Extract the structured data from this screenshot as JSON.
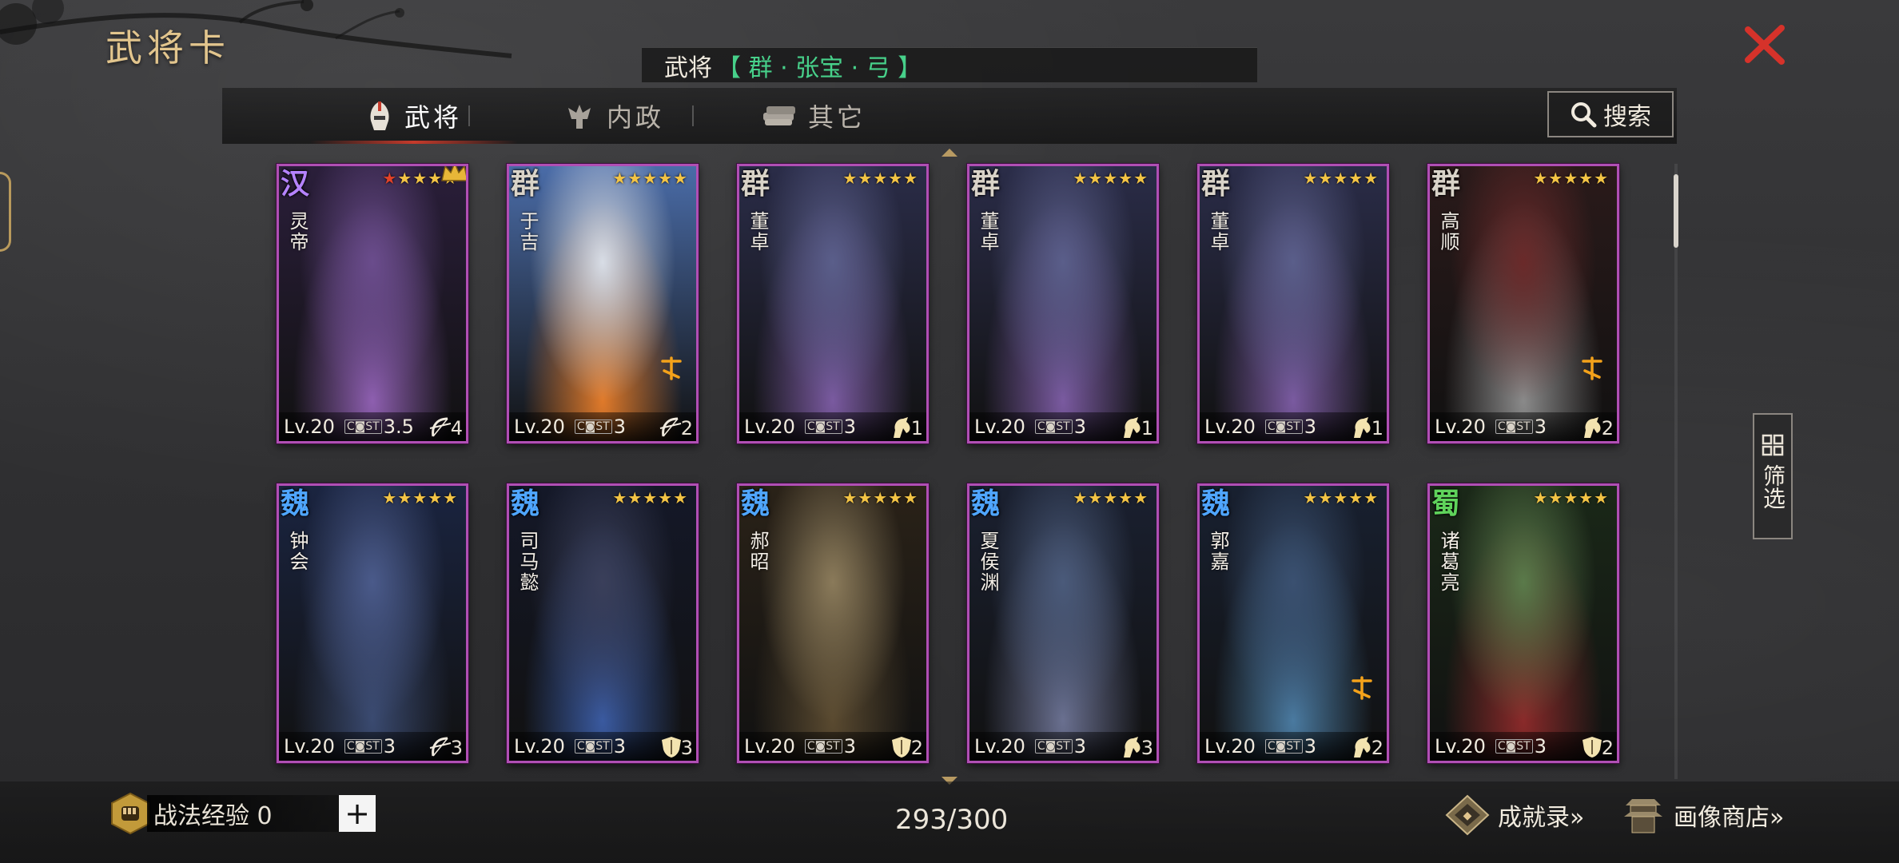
{
  "title": "武将卡",
  "selected": {
    "label": "武将",
    "value": "【 群 · 张宝 · 弓 】"
  },
  "tabs": [
    {
      "label": "武将",
      "icon": "helmet-icon",
      "active": true
    },
    {
      "label": "内政",
      "icon": "crown-ornament-icon",
      "active": false
    },
    {
      "label": "其它",
      "icon": "scroll-stack-icon",
      "active": false
    }
  ],
  "search_label": "搜索",
  "filter_label": "筛选",
  "cards": [
    {
      "faction": "汉",
      "faction_color": "#b583ff",
      "name": "灵帝",
      "stars": 5,
      "red_stars": 1,
      "level": "Lv.20",
      "cost": "3.5",
      "troop": "bow-icon",
      "troop_count": "4",
      "crown_badge": true,
      "awaken": false
    },
    {
      "faction": "群",
      "faction_color": "#d9d3c8",
      "name": "于吉",
      "stars": 5,
      "red_stars": 0,
      "level": "Lv.20",
      "cost": "3",
      "troop": "bow-icon",
      "troop_count": "2",
      "crown_badge": false,
      "awaken": true
    },
    {
      "faction": "群",
      "faction_color": "#d9d3c8",
      "name": "董卓",
      "stars": 5,
      "red_stars": 0,
      "level": "Lv.20",
      "cost": "3",
      "troop": "horse-icon",
      "troop_count": "1",
      "crown_badge": false,
      "awaken": false
    },
    {
      "faction": "群",
      "faction_color": "#d9d3c8",
      "name": "董卓",
      "stars": 5,
      "red_stars": 0,
      "level": "Lv.20",
      "cost": "3",
      "troop": "horse-icon",
      "troop_count": "1",
      "crown_badge": false,
      "awaken": false
    },
    {
      "faction": "群",
      "faction_color": "#d9d3c8",
      "name": "董卓",
      "stars": 5,
      "red_stars": 0,
      "level": "Lv.20",
      "cost": "3",
      "troop": "horse-icon",
      "troop_count": "1",
      "crown_badge": false,
      "awaken": false
    },
    {
      "faction": "群",
      "faction_color": "#d9d3c8",
      "name": "高顺",
      "stars": 5,
      "red_stars": 0,
      "level": "Lv.20",
      "cost": "3",
      "troop": "horse-icon",
      "troop_count": "2",
      "crown_badge": false,
      "awaken": true
    },
    {
      "faction": "魏",
      "faction_color": "#4fa6ff",
      "name": "钟会",
      "stars": 5,
      "red_stars": 0,
      "level": "Lv.20",
      "cost": "3",
      "troop": "bow-icon",
      "troop_count": "3",
      "crown_badge": false,
      "awaken": false
    },
    {
      "faction": "魏",
      "faction_color": "#4fa6ff",
      "name": "司马懿",
      "stars": 5,
      "red_stars": 0,
      "level": "Lv.20",
      "cost": "3",
      "troop": "shield-icon",
      "troop_count": "3",
      "crown_badge": false,
      "awaken": false
    },
    {
      "faction": "魏",
      "faction_color": "#4fa6ff",
      "name": "郝昭",
      "stars": 5,
      "red_stars": 0,
      "level": "Lv.20",
      "cost": "3",
      "troop": "shield-icon",
      "troop_count": "2",
      "crown_badge": false,
      "awaken": false
    },
    {
      "faction": "魏",
      "faction_color": "#4fa6ff",
      "name": "夏侯渊",
      "stars": 5,
      "red_stars": 0,
      "level": "Lv.20",
      "cost": "3",
      "troop": "horse-icon",
      "troop_count": "3",
      "crown_badge": false,
      "awaken": false
    },
    {
      "faction": "魏",
      "faction_color": "#4fa6ff",
      "name": "郭嘉",
      "stars": 5,
      "red_stars": 0,
      "level": "Lv.20",
      "cost": "3",
      "troop": "horse-icon",
      "troop_count": "2",
      "crown_badge": false,
      "awaken": true
    },
    {
      "faction": "蜀",
      "faction_color": "#5fd35b",
      "name": "诸葛亮",
      "stars": 5,
      "red_stars": 0,
      "level": "Lv.20",
      "cost": "3",
      "troop": "shield-icon",
      "troop_count": "2",
      "crown_badge": false,
      "awaken": false
    }
  ],
  "exp": {
    "label": "战法经验 0",
    "plus": "+"
  },
  "card_count": "293/300",
  "links": {
    "achievements": "成就录»",
    "portrait_shop": "画像商店»"
  },
  "colors": {
    "accent_gold": "#e2c58d",
    "card_border": "#b04fb4",
    "close_red": "#d6322a",
    "selection_green": "#47d08a"
  }
}
